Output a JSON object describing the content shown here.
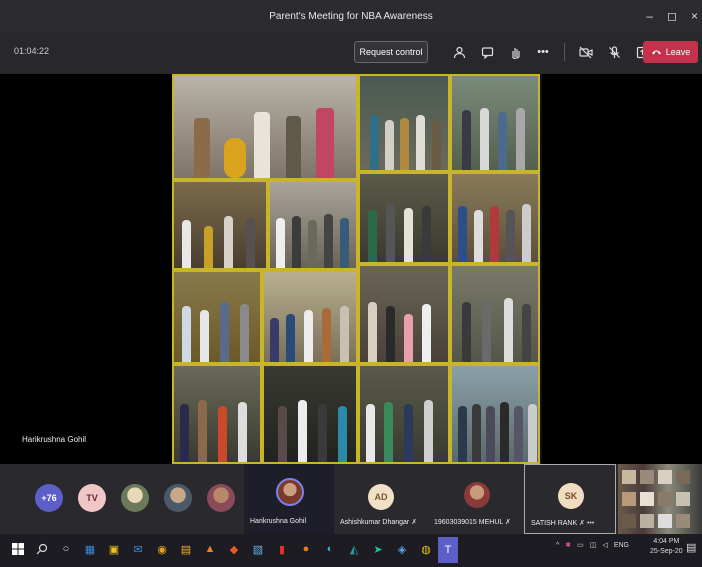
{
  "window": {
    "title": "Parent's Meeting for NBA Awareness",
    "minimize": "–",
    "maximize": "◻",
    "close": "×"
  },
  "toolbar": {
    "timer": "01:04:22",
    "request_control": "Request control",
    "leave": "Leave"
  },
  "stage": {
    "speaker_name": "Harikrushna Gohil"
  },
  "participants": [
    {
      "initials": "+76",
      "color": "#5b5fc7"
    },
    {
      "initials": "TV",
      "color": "#f1c6c6"
    },
    {
      "initials": "",
      "color": "#c8b58a"
    },
    {
      "initials": "",
      "color": "#8aa0b8"
    },
    {
      "initials": "",
      "color": "#b88a7a"
    }
  ],
  "featured": [
    {
      "name": "Harikrushna Gohil"
    },
    {
      "name": "Ashishkumar Dhangar",
      "initials": "AD"
    },
    {
      "name": "19603039015 MEHUL"
    },
    {
      "name": "SATISH RANK",
      "initials": "SK"
    }
  ],
  "taskbar": {
    "tray_lang": "ENG",
    "time": "4:04 PM",
    "date": "25-Sep-20"
  }
}
